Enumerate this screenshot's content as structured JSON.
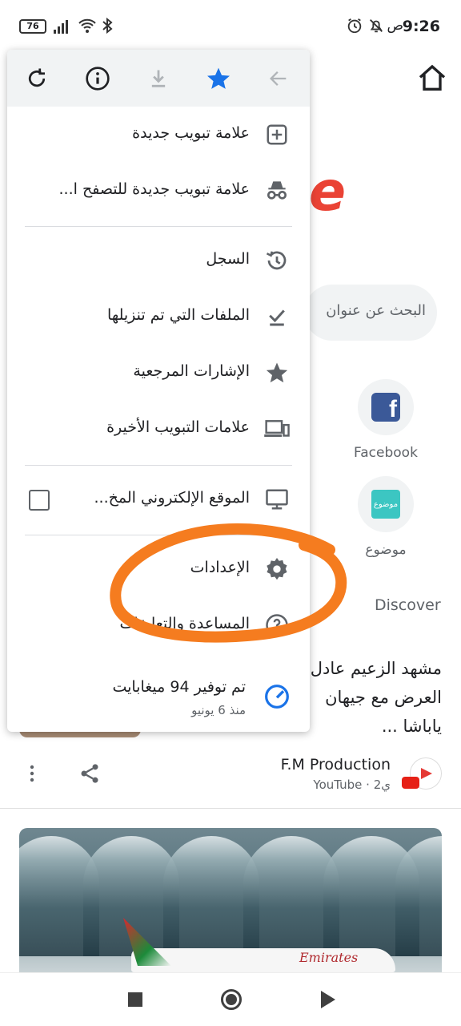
{
  "status_bar": {
    "time": "9:26",
    "ampm": "ص",
    "battery": "76",
    "icons": [
      "alarm-icon",
      "mute-icon",
      "signal-icon",
      "wifi-icon",
      "bluetooth-icon",
      "battery-icon"
    ]
  },
  "page": {
    "search_placeholder": "البحث عن عنوان",
    "logo_partial": "e",
    "shortcuts": [
      {
        "label": "Facebook",
        "icon": "facebook-icon"
      },
      {
        "label": "موضوع",
        "tile_text": "موضوع",
        "icon": "mawdoo3-icon"
      }
    ],
    "discover_label": "Discover",
    "article": {
      "title_lines": [
        "مشهد الزعيم عادل",
        "العرض مع جيهان",
        "ياباشا ..."
      ],
      "source_name": "F.M Production",
      "source_meta": "YouTube · 2ي"
    }
  },
  "menu": {
    "toolbar": [
      "forward-icon",
      "bookmark-star-icon",
      "download-icon",
      "info-icon",
      "refresh-icon"
    ],
    "items": [
      {
        "label": "علامة تبويب جديدة",
        "icon": "new-tab-icon"
      },
      {
        "label": "علامة تبويب جديدة للتصفح ا...",
        "icon": "incognito-icon"
      },
      {
        "label": "السجل",
        "icon": "history-icon"
      },
      {
        "label": "الملفات التي تم تنزيلها",
        "icon": "downloads-icon"
      },
      {
        "label": "الإشارات المرجعية",
        "icon": "bookmarks-icon"
      },
      {
        "label": "علامات التبويب الأخيرة",
        "icon": "recent-tabs-icon"
      },
      {
        "label": "الموقع الإلكتروني المخ...",
        "icon": "desktop-site-icon",
        "checked": false
      },
      {
        "label": "الإعدادات",
        "icon": "settings-icon"
      },
      {
        "label": "المساعدة والتعليقات",
        "icon": "help-icon"
      }
    ],
    "savings": {
      "title": "تم توفير 94 ميغابايت",
      "subtitle": "منذ 6 يونيو"
    }
  },
  "colors": {
    "accent_blue": "#1a73e8",
    "annotation_orange": "#f57c1f",
    "menu_icon_gray": "#5f6368"
  }
}
